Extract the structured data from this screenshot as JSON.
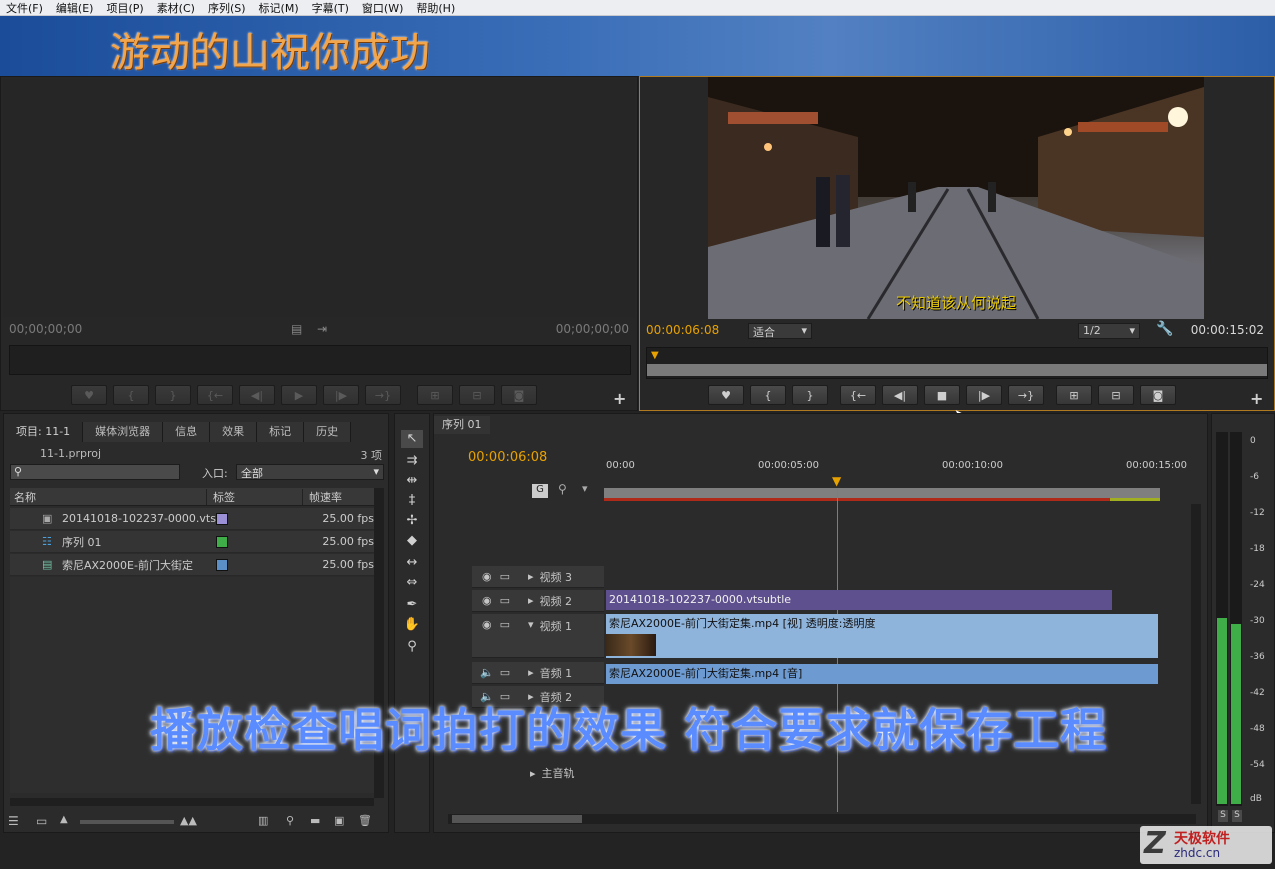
{
  "menu": [
    "文件(F)",
    "编辑(E)",
    "项目(P)",
    "素材(C)",
    "序列(S)",
    "标记(M)",
    "字幕(T)",
    "窗口(W)",
    "帮助(H)"
  ],
  "banner": {
    "title": "游动的山祝你成功"
  },
  "source_monitor": {
    "timecode_left": "00;00;00;00",
    "timecode_right": "00;00;00;00"
  },
  "program_monitor": {
    "timecode_current": "00:00:06:08",
    "fit": "适合",
    "resolution": "1/2",
    "timecode_duration": "00:00:15:02",
    "subtitle": "不知道该从何说起"
  },
  "project_panel": {
    "tabs": [
      "项目: 11-1",
      "媒体浏览器",
      "信息",
      "效果",
      "标记",
      "历史"
    ],
    "project_file": "11-1.prproj",
    "item_count": "3 项",
    "inpoint_label": "入口:",
    "inpoint_value": "全部",
    "columns": [
      "名称",
      "标签",
      "帧速率"
    ],
    "items": [
      {
        "name": "20141018-102237-0000.vts",
        "fps": "25.00 fps",
        "color": "#9b8fd6"
      },
      {
        "name": "序列 01",
        "fps": "25.00 fps",
        "color": "#3fae49"
      },
      {
        "name": "索尼AX2000E-前门大街定",
        "fps": "25.00 fps",
        "color": "#5a8fc8"
      }
    ]
  },
  "timeline": {
    "tab": "序列 01",
    "timecode": "00:00:06:08",
    "ruler": [
      "00:00",
      "00:00:05:00",
      "00:00:10:00",
      "00:00:15:00"
    ],
    "tracks": {
      "v3": "视频 3",
      "v2": "视频 2",
      "v1": "视频 1",
      "a1": "音频 1",
      "a2": "音频 2",
      "master": "主音轨"
    },
    "clips": {
      "v2": "20141018-102237-0000.vtsubtle",
      "v1": "索尼AX2000E-前门大街定集.mp4 [视] 透明度:透明度",
      "a1": "索尼AX2000E-前门大街定集.mp4 [音]"
    }
  },
  "meters": {
    "scale": [
      "0",
      "-6",
      "-12",
      "-18",
      "-24",
      "-30",
      "-36",
      "-42",
      "-48",
      "-54",
      "dB"
    ],
    "solo": [
      "S",
      "S"
    ]
  },
  "overlay_caption": "播放检查唱词拍打的效果 符合要求就保存工程",
  "watermark": {
    "line1": "天极软件",
    "line2": "zhdc.cn"
  }
}
